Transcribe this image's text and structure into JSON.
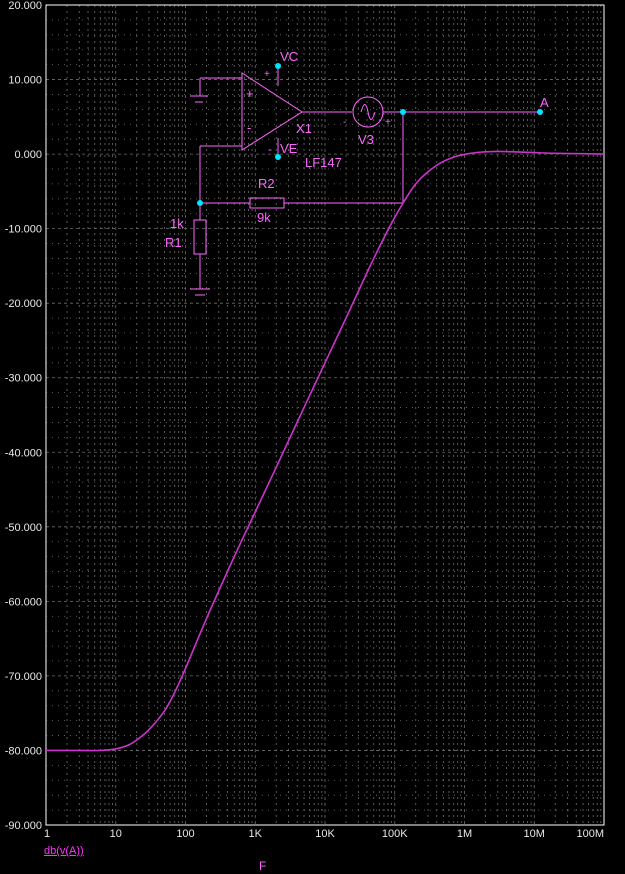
{
  "chart_data": {
    "type": "line",
    "x_scale": "log",
    "xlim": [
      1,
      100000000
    ],
    "ylim": [
      -90,
      20
    ],
    "grid": true,
    "background": "#000000",
    "grid_color": "#6e6e6e",
    "trace_color": "#cc33cc",
    "xlabel": "F",
    "ylabel": "",
    "y_ticks": [
      "20.000",
      "10.000",
      "0.000",
      "-10.000",
      "-20.000",
      "-30.000",
      "-40.000",
      "-50.000",
      "-60.000",
      "-70.000",
      "-80.000",
      "-90.000"
    ],
    "x_ticks": [
      "1",
      "10",
      "100",
      "1K",
      "10K",
      "100K",
      "1M",
      "10M",
      "100M"
    ],
    "series": [
      {
        "name": "db(v(A))",
        "x": [
          1,
          3,
          6,
          10,
          15,
          20,
          30,
          50,
          70,
          100,
          200,
          500,
          1000,
          2000,
          5000,
          10000,
          20000,
          50000,
          100000,
          200000,
          400000,
          700000,
          1000000,
          1500000,
          2000000,
          3000000,
          5000000,
          10000000,
          20000000,
          50000000,
          100000000
        ],
        "y": [
          -80,
          -80,
          -80,
          -79.8,
          -79.3,
          -78.6,
          -77.2,
          -74.7,
          -72.2,
          -69.0,
          -62.3,
          -54.0,
          -48.0,
          -42.0,
          -34.0,
          -28.0,
          -22.0,
          -14.0,
          -8.5,
          -4.0,
          -1.5,
          -0.4,
          -0.05,
          0.2,
          0.3,
          0.35,
          0.3,
          0.2,
          0.1,
          0.05,
          0
        ]
      }
    ]
  },
  "schematic": {
    "node_vc": "VC",
    "node_ve": "VE",
    "node_a": "A",
    "opamp_ref": "X1",
    "opamp_model": "LF147",
    "source_ref": "V3",
    "r1_ref": "R1",
    "r1_value": "1k",
    "r2_ref": "R2",
    "r2_value": "9k",
    "plus_sign": "+",
    "minus_sign": "-"
  },
  "legend_label": "db(v(A))",
  "x_axis_label": "F"
}
